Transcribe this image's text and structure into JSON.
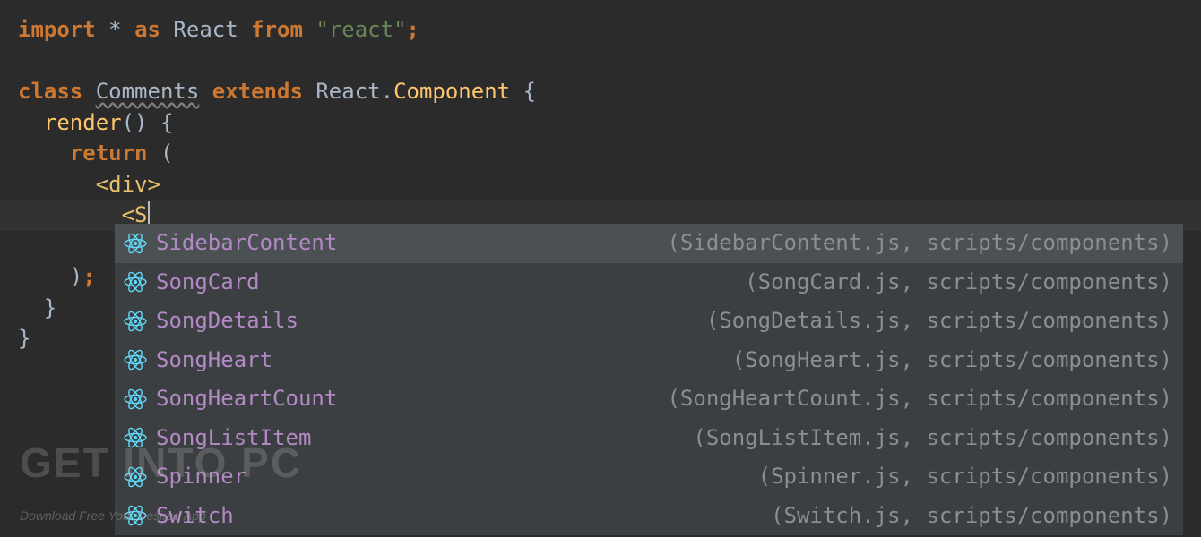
{
  "code": {
    "import_kw": "import",
    "import_star": "*",
    "import_as": "as",
    "import_alias": "React",
    "import_from": "from",
    "import_path": "\"react\"",
    "class_kw": "class",
    "class_name": "Comments",
    "extends_kw": "extends",
    "parent_ns": "React",
    "parent_dot": ".",
    "parent_class": "Component",
    "render_name": "render",
    "return_kw": "return",
    "div_tag": "div",
    "typed": "S"
  },
  "autocomplete": [
    {
      "name": "SidebarContent",
      "path": "(SidebarContent.js, scripts/components)",
      "selected": true
    },
    {
      "name": "SongCard",
      "path": "(SongCard.js, scripts/components)",
      "selected": false
    },
    {
      "name": "SongDetails",
      "path": "(SongDetails.js, scripts/components)",
      "selected": false
    },
    {
      "name": "SongHeart",
      "path": "(SongHeart.js, scripts/components)",
      "selected": false
    },
    {
      "name": "SongHeartCount",
      "path": "(SongHeartCount.js, scripts/components)",
      "selected": false
    },
    {
      "name": "SongListItem",
      "path": "(SongListItem.js, scripts/components)",
      "selected": false
    },
    {
      "name": "Spinner",
      "path": "(Spinner.js, scripts/components)",
      "selected": false
    },
    {
      "name": "Switch",
      "path": "(Switch.js, scripts/components)",
      "selected": false
    }
  ],
  "watermark": {
    "line1": "GET INTO PC",
    "line2": "Download Free Your Desired App"
  }
}
